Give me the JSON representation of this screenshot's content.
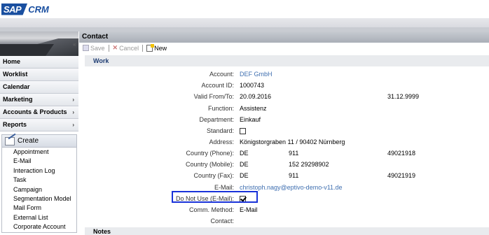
{
  "header": {
    "logo_box": "SAP",
    "logo_text": "CRM"
  },
  "nav": {
    "items": [
      {
        "label": "Home",
        "arrow": ""
      },
      {
        "label": "Worklist",
        "arrow": ""
      },
      {
        "label": "Calendar",
        "arrow": ""
      },
      {
        "label": "Marketing",
        "arrow": "›"
      },
      {
        "label": "Accounts & Products",
        "arrow": "›"
      },
      {
        "label": "Reports",
        "arrow": "›"
      }
    ],
    "create": {
      "label": "Create",
      "items": [
        "Appointment",
        "E-Mail",
        "Interaction Log",
        "Task",
        "Campaign",
        "Segmentation Model",
        "Mail Form",
        "External List",
        "Corporate Account"
      ]
    }
  },
  "main": {
    "title": "Contact",
    "toolbar": {
      "save": "Save",
      "cancel": "Cancel",
      "new": "New"
    },
    "section_work": "Work",
    "section_notes": "Notes",
    "fields": {
      "account": {
        "label": "Account:",
        "value": "DEF GmbH"
      },
      "account_id": {
        "label": "Account ID:",
        "value": "1000743"
      },
      "valid": {
        "label": "Valid From/To:",
        "from": "20.09.2016",
        "to": "31.12.9999"
      },
      "function": {
        "label": "Function:",
        "value": "Assistenz"
      },
      "department": {
        "label": "Department:",
        "value": "Einkauf"
      },
      "standard": {
        "label": "Standard:",
        "checked": false
      },
      "address": {
        "label": "Address:",
        "value": "Königstorgraben 11 / 90402 Nürnberg"
      },
      "phone": {
        "label": "Country (Phone):",
        "country": "DE",
        "area": "911",
        "number": "49021918"
      },
      "mobile": {
        "label": "Country (Mobile):",
        "country": "DE",
        "area": "152 29298902"
      },
      "fax": {
        "label": "Country (Fax):",
        "country": "DE",
        "area": "911",
        "number": "49021919"
      },
      "email": {
        "label": "E-Mail:",
        "value": "christoph.nagy@eptivo-demo-v11.de"
      },
      "do_not_use": {
        "label": "Do Not Use (E-Mail):",
        "checked": true
      },
      "comm_method": {
        "label": "Comm. Method:",
        "value": "E-Mail"
      },
      "contact": {
        "label": "Contact:",
        "value": ""
      }
    }
  },
  "colors": {
    "brand": "#1a4fa0",
    "link": "#3f6fb0",
    "highlight": "#1a33d9"
  }
}
